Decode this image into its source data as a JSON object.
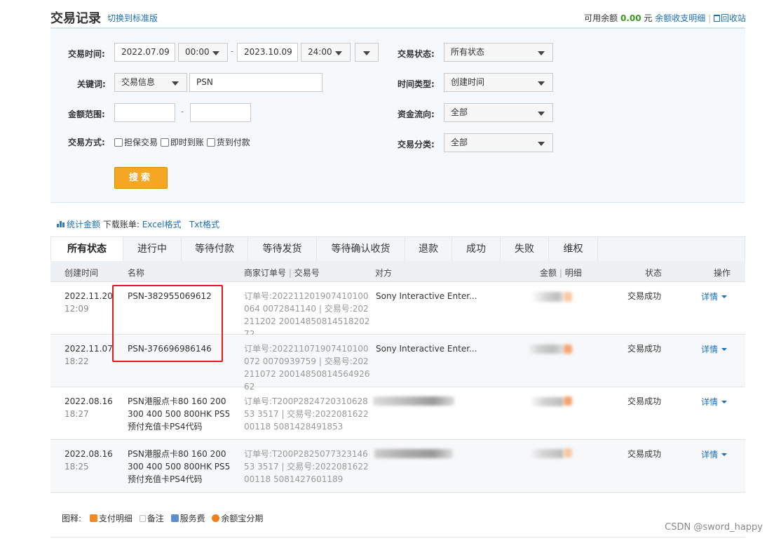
{
  "header": {
    "title": "交易记录",
    "switch_link": "切换到标准版",
    "balance_label": "可用余额",
    "balance_amount": "0.00",
    "balance_unit": "元",
    "balance_detail_link": "余额收支明细",
    "recycle_link": "回收站"
  },
  "filters": {
    "time_label": "交易时间:",
    "start_date": "2022.07.09",
    "start_time": "00:00",
    "end_date": "2023.10.09",
    "end_time": "24:00",
    "keyword_label": "关键词:",
    "keyword_type": "交易信息",
    "keyword_value": "PSN",
    "amount_label": "金额范围:",
    "amount_sep": "-",
    "time_sep": "-",
    "method_label": "交易方式:",
    "method_options": [
      "担保交易",
      "即时到账",
      "货到付款"
    ],
    "status_label": "交易状态:",
    "status_value": "所有状态",
    "time_type_label": "时间类型:",
    "time_type_value": "创建时间",
    "flow_label": "资金流向:",
    "flow_value": "全部",
    "category_label": "交易分类:",
    "category_value": "全部",
    "search_button": "搜索"
  },
  "toolbar": {
    "stats_link": "统计金额",
    "download_label": "下载账单:",
    "excel_link": "Excel格式",
    "txt_link": "Txt格式"
  },
  "tabs": [
    "所有状态",
    "进行中",
    "等待付款",
    "等待发货",
    "等待确认收货",
    "退款",
    "成功",
    "失败",
    "维权"
  ],
  "table": {
    "headers": {
      "created": "创建时间",
      "name": "名称",
      "merchant_order": "商家订单号",
      "trade_no": "交易号",
      "party": "对方",
      "amount": "金额",
      "detail": "明细",
      "status": "状态",
      "action": "操作"
    },
    "rows": [
      {
        "date": "2022.11.20",
        "time": "12:09",
        "name": "PSN-382955069612",
        "order": "订单号:202211201907410100064 0072841140 | 交易号:202211202 2001485081451820272",
        "party": "Sony Interactive Enter...",
        "status": "交易成功",
        "action": "详情"
      },
      {
        "date": "2022.11.07",
        "time": "18:22",
        "name": "PSN-376696986146",
        "order": "订单号:202211071907410100072 0070939759 | 交易号:202211072 2001485081456492662",
        "party": "Sony Interactive Enter...",
        "status": "交易成功",
        "action": "详情"
      },
      {
        "date": "2022.08.16",
        "time": "18:27",
        "name": "PSN港服点卡80 160 200 300 400 500 800HK PS5预付充值卡PS4代码",
        "order": "订单号:T200P282472031062853 3517 | 交易号:202208162200118 5081428491853",
        "party": "",
        "status": "交易成功",
        "action": "详情"
      },
      {
        "date": "2022.08.16",
        "time": "18:25",
        "name": "PSN港服点卡80 160 200 300 400 500 800HK PS5预付充值卡PS4代码",
        "order": "订单号:T200P282507732314653 3517 | 交易号:202208162200118 5081427601189",
        "party": "",
        "status": "交易成功",
        "action": "详情"
      }
    ]
  },
  "legend": {
    "label": "图释:",
    "items": [
      "支付明细",
      "备注",
      "服务费",
      "余额宝分期"
    ]
  },
  "watermark": "CSDN @sword_happy"
}
